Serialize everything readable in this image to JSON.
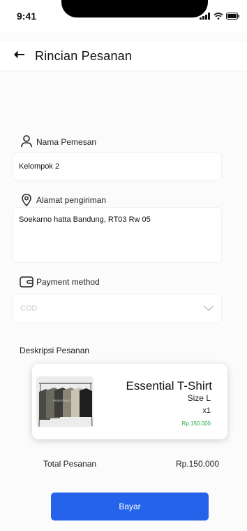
{
  "status_bar": {
    "time": "9:41"
  },
  "header": {
    "title": "Rincian Pesanan"
  },
  "form": {
    "name_label": "Nama Pemesan",
    "name_value": "Kelompok 2",
    "address_label": "Alamat pengiriman",
    "address_value": "Soekarno hatta Bandung, RT03 Rw 05",
    "payment_label": "Payment method",
    "payment_value": "COD"
  },
  "order": {
    "section_title": "Deskripsi Pesanan",
    "product": {
      "name": "Essential T-Shirt",
      "size": "Size L",
      "quantity": "x1",
      "price": "Rp.150.000"
    },
    "total_label": "Total Pesanan",
    "total_value": "Rp.150.000"
  },
  "actions": {
    "pay_label": "Bayar"
  },
  "colors": {
    "primary": "#2563eb",
    "price": "#22a84b"
  }
}
